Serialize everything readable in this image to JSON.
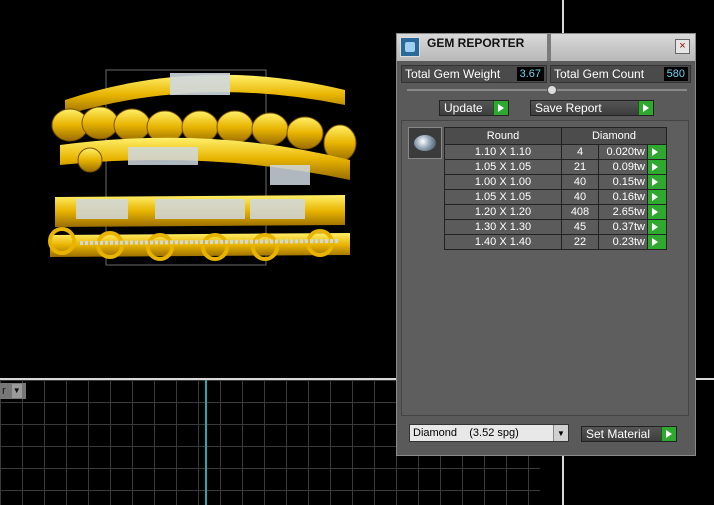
{
  "panel": {
    "title": "GEM REPORTER",
    "close": "×",
    "total_weight_label": "Total Gem Weight",
    "total_weight_value": "3.67",
    "total_count_label": "Total Gem Count",
    "total_count_value": "580",
    "update_label": "Update",
    "save_report_label": "Save Report",
    "table": {
      "headers": [
        "Round",
        "Diamond"
      ],
      "rows": [
        {
          "size": "1.10 X 1.10",
          "count": "4",
          "tw": "0.020tw"
        },
        {
          "size": "1.05 X 1.05",
          "count": "21",
          "tw": "0.09tw"
        },
        {
          "size": "1.00 X 1.00",
          "count": "40",
          "tw": "0.15tw"
        },
        {
          "size": "1.05 X 1.05",
          "count": "40",
          "tw": "0.16tw"
        },
        {
          "size": "1.20 X 1.20",
          "count": "408",
          "tw": "2.65tw"
        },
        {
          "size": "1.30 X 1.30",
          "count": "45",
          "tw": "0.37tw"
        },
        {
          "size": "1.40 X 1.40",
          "count": "22",
          "tw": "0.23tw"
        }
      ]
    },
    "material_value": "Diamond    (3.52 spg)",
    "set_material_label": "Set Material"
  },
  "viewport": {
    "label": "r"
  },
  "colors": {
    "gold": "#e8b400",
    "accent_green": "#2ea82e",
    "value_cyan": "#6fd6f0"
  }
}
